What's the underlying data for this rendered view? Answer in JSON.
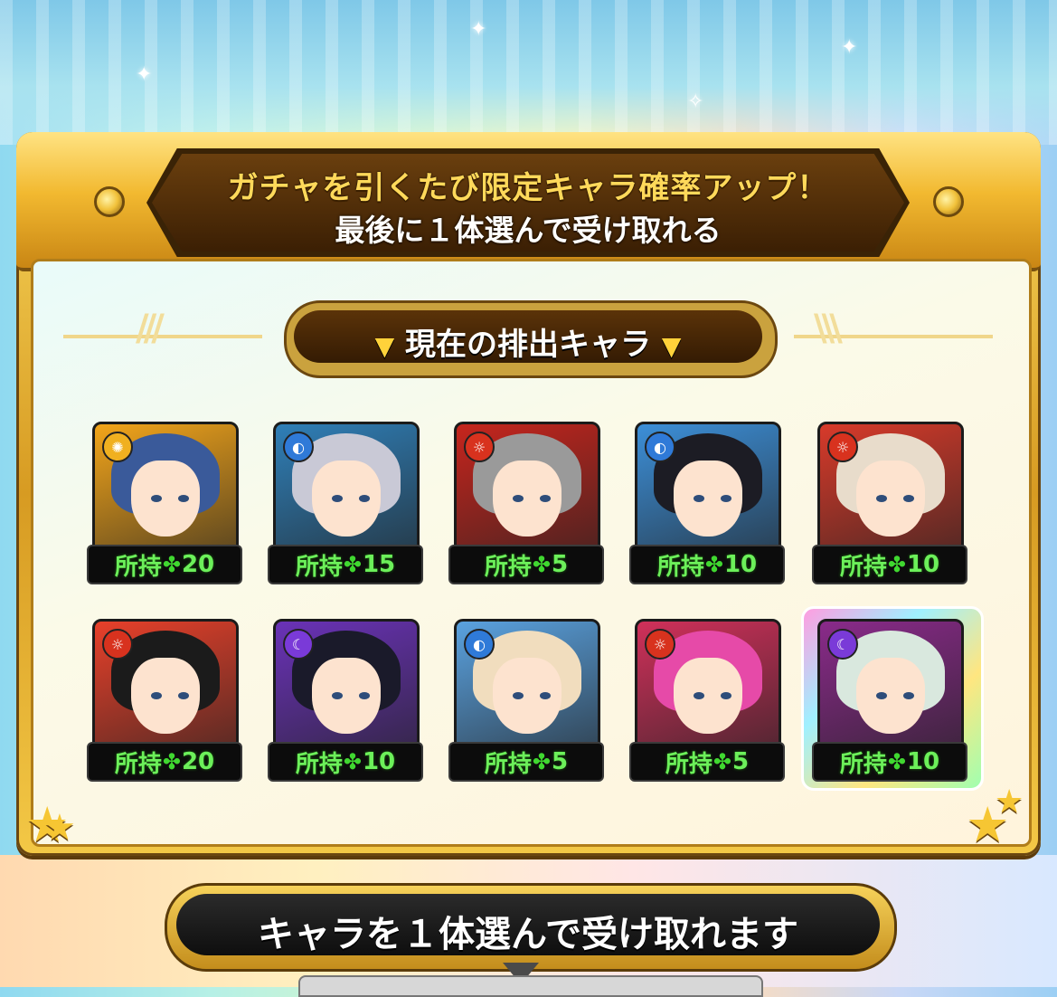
{
  "banner": {
    "line1": "ガチャを引くたび限定キャラ確率アップ！",
    "line2": "最後に１体選んで受け取れる"
  },
  "section": {
    "title": "現在の排出キャラ"
  },
  "characters": [
    {
      "owned_label": "所持",
      "count": "20",
      "attribute": "light",
      "attr_color": "#f0b020",
      "bg": "#f3a51a",
      "hair": "#3a5a9a"
    },
    {
      "owned_label": "所持",
      "count": "15",
      "attribute": "water",
      "attr_color": "#2f7ad8",
      "bg": "#2f7fb8",
      "hair": "#c9c9d6"
    },
    {
      "owned_label": "所持",
      "count": "5",
      "attribute": "fire",
      "attr_color": "#d8321e",
      "bg": "#c6251d",
      "hair": "#9a9a9a"
    },
    {
      "owned_label": "所持",
      "count": "10",
      "attribute": "water",
      "attr_color": "#2f7ad8",
      "bg": "#3c8fd8",
      "hair": "#1c1c24"
    },
    {
      "owned_label": "所持",
      "count": "10",
      "attribute": "fire",
      "attr_color": "#d8321e",
      "bg": "#d83a2a",
      "hair": "#e8dccb"
    },
    {
      "owned_label": "所持",
      "count": "20",
      "attribute": "fire",
      "attr_color": "#d8321e",
      "bg": "#e8402a",
      "hair": "#1b1b1b"
    },
    {
      "owned_label": "所持",
      "count": "10",
      "attribute": "dark",
      "attr_color": "#7a3ad8",
      "bg": "#6a32b8",
      "hair": "#1a1a2a"
    },
    {
      "owned_label": "所持",
      "count": "5",
      "attribute": "water",
      "attr_color": "#2f7ad8",
      "bg": "#5aa2e0",
      "hair": "#f1ddbe"
    },
    {
      "owned_label": "所持",
      "count": "5",
      "attribute": "fire",
      "attr_color": "#d8321e",
      "bg": "#d0305a",
      "hair": "#e64aa8"
    },
    {
      "owned_label": "所持",
      "count": "10",
      "attribute": "dark",
      "attr_color": "#7a3ad8",
      "bg": "#8a2a8a",
      "hair": "#d9e8de"
    }
  ],
  "footer": {
    "button_label": "キャラを１体選んで受け取れます"
  }
}
